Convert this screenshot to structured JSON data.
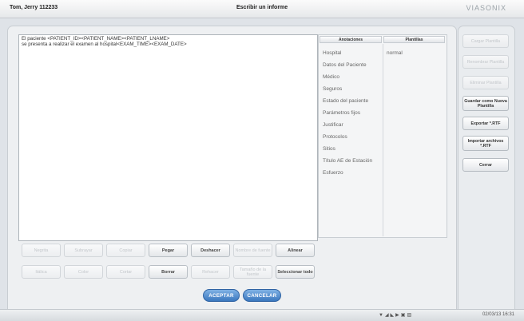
{
  "header": {
    "patient": "Tom, Jerry 112233",
    "title": "Escribir un informe",
    "logo": "VIASONIX"
  },
  "editor": {
    "line1": "El paciente <PATIENT_ID><PATIENT_NAME><PATIENT_LNAME>",
    "line2": "se presenta a realizar el examen al hospital<EXAM_TIME><EXAM_DATE>"
  },
  "toolbar": {
    "row1": [
      {
        "label": "Negrita",
        "enabled": false
      },
      {
        "label": "Subrayar",
        "enabled": false
      },
      {
        "label": "Copiar",
        "enabled": false
      },
      {
        "label": "Pegar",
        "enabled": true
      },
      {
        "label": "Deshacer",
        "enabled": true
      },
      {
        "label": "Nombre de fuente",
        "enabled": false
      },
      {
        "label": "Alinear",
        "enabled": true
      }
    ],
    "row2": [
      {
        "label": "Itálica",
        "enabled": false
      },
      {
        "label": "Color",
        "enabled": false
      },
      {
        "label": "Cortar",
        "enabled": false
      },
      {
        "label": "Borrar",
        "enabled": true
      },
      {
        "label": "Rehacer",
        "enabled": false
      },
      {
        "label": "Tamaño de la fuente",
        "enabled": false
      },
      {
        "label": "Seleccionar todo",
        "enabled": true
      }
    ]
  },
  "annotations": {
    "col1_header": "Anotaciones",
    "col2_header": "Plantillas",
    "items": [
      "Hospital",
      "Datos del Paciente",
      "Médico",
      "Seguros",
      "Estado del paciente",
      "Parámetros fijos",
      "Justificar",
      "Protocolos",
      "Sitios",
      "Título AE de Estación",
      "Esfuerzo"
    ],
    "templates": [
      "normal"
    ]
  },
  "side": [
    {
      "label": "Cargar Plantilla",
      "enabled": false
    },
    {
      "label": "Renombrar Plantilla",
      "enabled": false
    },
    {
      "label": "Eliminar Plantilla",
      "enabled": false
    },
    {
      "label": "Guardar como Nueva Plantilla",
      "enabled": true
    },
    {
      "label": "Exportar *.RTF",
      "enabled": true
    },
    {
      "label": "Importar archivos *.RTF",
      "enabled": true
    },
    {
      "label": "Cerrar",
      "enabled": true
    }
  ],
  "actions": {
    "accept": "ACEPTAR",
    "cancel": "CANCELAR"
  },
  "taskbar": {
    "clock": "02/03/13 16:31"
  }
}
